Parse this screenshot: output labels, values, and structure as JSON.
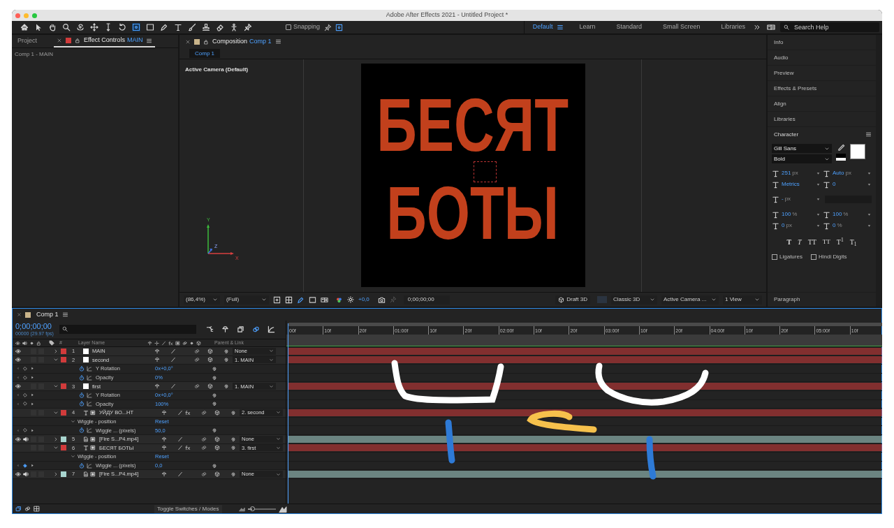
{
  "window": {
    "title": "Adobe After Effects 2021 - Untitled Project *"
  },
  "toolbar": {
    "snapping": {
      "label": "Snapping",
      "checked": false
    }
  },
  "workspaces": [
    {
      "label": "Default",
      "selected": true
    },
    {
      "label": "Learn",
      "selected": false
    },
    {
      "label": "Standard",
      "selected": false
    },
    {
      "label": "Small Screen",
      "selected": false
    },
    {
      "label": "Libraries",
      "selected": false
    }
  ],
  "search_help": {
    "placeholder": "Search Help"
  },
  "left_panel": {
    "tabs": [
      {
        "label": "Project",
        "selected": false
      },
      {
        "label": "Effect Controls",
        "target": "MAIN",
        "selected": true
      }
    ],
    "subtitle": "Comp 1 - MAIN"
  },
  "composition_panel": {
    "tab": {
      "label": "Composition",
      "target": "Comp 1"
    },
    "viewer_tabs": [
      {
        "label": "Comp 1",
        "selected": true
      }
    ],
    "camera": "Active Camera (Default)",
    "frame_text": [
      "БЕСЯТ",
      "БОТЫ"
    ],
    "axes": [
      "Y",
      "Z",
      "X"
    ],
    "bar": {
      "magnification": "(86,4%)",
      "resolution": "(Full)",
      "exposure": "+0,0",
      "timecode": "0;00;00;00",
      "draft_3d": "Draft 3D",
      "renderer": "Classic 3D",
      "view": "Active Camera ...",
      "layout": "1 View"
    }
  },
  "right_panels": [
    "Info",
    "Audio",
    "Preview",
    "Effects & Presets",
    "Align",
    "Libraries"
  ],
  "character": {
    "title": "Character",
    "font": "Gill Sans",
    "style": "Bold",
    "size": {
      "value": "251",
      "unit": "px"
    },
    "leading": {
      "value": "Auto",
      "unit": "px"
    },
    "kerning": {
      "value": "Metrics"
    },
    "tracking": {
      "value": "0"
    },
    "stroke": {
      "value": "-",
      "unit": "px"
    },
    "vertical_scale": {
      "value": "100",
      "unit": "%"
    },
    "horizontal_scale": {
      "value": "100",
      "unit": "%"
    },
    "baseline_shift": {
      "value": "0",
      "unit": "px"
    },
    "tsume": {
      "value": "0",
      "unit": "%"
    },
    "style_buttons": [
      {
        "label": "T",
        "kind": "bold"
      },
      {
        "label": "T",
        "kind": "italic"
      },
      {
        "label": "TT",
        "kind": "caps"
      },
      {
        "label": "TT",
        "kind": "small_caps"
      },
      {
        "label": "T$^{1}$",
        "kind": "super"
      },
      {
        "label": "T$_{1}$",
        "kind": "sub"
      }
    ],
    "options": [
      {
        "label": "Ligatures",
        "checked": false
      },
      {
        "label": "Hindi Digits",
        "checked": false
      }
    ]
  },
  "paragraph": {
    "title": "Paragraph"
  },
  "timeline": {
    "tab": "Comp 1",
    "timecode": "0;00;00;00",
    "fps": "00000 (29.97 fps)",
    "columns": {
      "number": "#",
      "name": "Layer Name",
      "parent": "Parent & Link"
    },
    "ruler": [
      "00f",
      "10f",
      "20f",
      "01:00f",
      "10f",
      "20f",
      "02:00f",
      "10f",
      "20f",
      "03:00f",
      "10f",
      "20f",
      "04:00f",
      "10f",
      "20f",
      "05:00f",
      "10f"
    ],
    "rows": [
      {
        "kind": "solid",
        "number": "1",
        "name": "MAIN",
        "color": "#d13b3b",
        "visible": true,
        "audio": false,
        "expanded": false,
        "fx": false,
        "parent": "None"
      },
      {
        "kind": "solid",
        "number": "2",
        "name": "second",
        "color": "#d13b3b",
        "visible": true,
        "audio": false,
        "expanded": true,
        "fx": false,
        "parent": "1. MAIN"
      },
      {
        "kind": "property",
        "name": "Y Rotation",
        "value": "0x+0,0°",
        "at_keyframe": false
      },
      {
        "kind": "property",
        "name": "Opacity",
        "value": "0%",
        "at_keyframe": false
      },
      {
        "kind": "solid",
        "number": "3",
        "name": "first",
        "color": "#d13b3b",
        "visible": true,
        "audio": false,
        "expanded": true,
        "fx": false,
        "parent": "1. MAIN"
      },
      {
        "kind": "property",
        "name": "Y Rotation",
        "value": "0x+0,0°",
        "at_keyframe": false
      },
      {
        "kind": "property",
        "name": "Opacity",
        "value": "100%",
        "at_keyframe": false
      },
      {
        "kind": "text",
        "number": "4",
        "name": "УЙДУ ВО...НТ",
        "color": "#d13b3b",
        "visible": false,
        "audio": false,
        "expanded": true,
        "fx": true,
        "parent": "2. second"
      },
      {
        "kind": "effect",
        "name": "Wiggle - position",
        "action": "Reset"
      },
      {
        "kind": "property",
        "name": "Wiggle ... (pixels)",
        "value": "50,0",
        "at_keyframe": false
      },
      {
        "kind": "footage",
        "number": "5",
        "name": "[Fire S...P4.mp4]",
        "color": "#a8d5cf",
        "visible": true,
        "audio": true,
        "expanded": false,
        "fx": false,
        "parent": "None"
      },
      {
        "kind": "text",
        "number": "6",
        "name": "БЕСЯТ БОТЫ",
        "color": "#d13b3b",
        "visible": false,
        "audio": false,
        "expanded": true,
        "fx": true,
        "parent": "3. first"
      },
      {
        "kind": "effect",
        "name": "Wiggle - position",
        "action": "Reset"
      },
      {
        "kind": "property",
        "name": "Wiggle ... (pixels)",
        "value": "0,0",
        "at_keyframe": true
      },
      {
        "kind": "footage",
        "number": "7",
        "name": "[Fire S...P4.mp4]",
        "color": "#a8d5cf",
        "visible": true,
        "audio": true,
        "expanded": false,
        "fx": false,
        "parent": "None"
      }
    ],
    "footer": "Toggle Switches / Modes",
    "zoom_slider": {
      "level": 0.15
    }
  }
}
